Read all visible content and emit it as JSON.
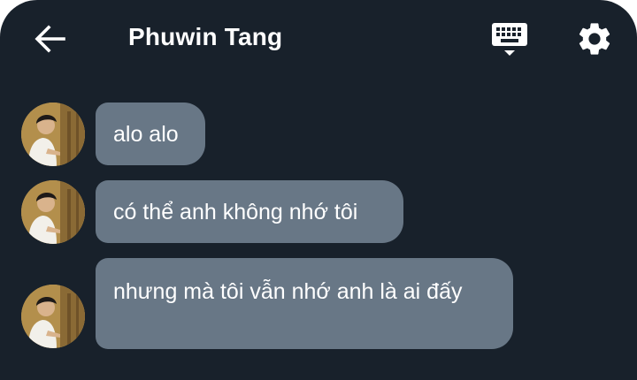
{
  "header": {
    "title": "Phuwin Tang",
    "icons": {
      "back": "arrow-left-icon",
      "keyboard": "keyboard-icon",
      "settings": "gear-icon"
    }
  },
  "messages": [
    {
      "text": "alo alo",
      "sender": "Phuwin Tang"
    },
    {
      "text": "có thể anh không nhớ tôi",
      "sender": "Phuwin Tang"
    },
    {
      "text": "nhưng mà tôi vẫn nhớ anh là ai đấy",
      "sender": "Phuwin Tang"
    }
  ],
  "colors": {
    "background": "#18212b",
    "bubble": "#687786",
    "text": "#ffffff"
  }
}
